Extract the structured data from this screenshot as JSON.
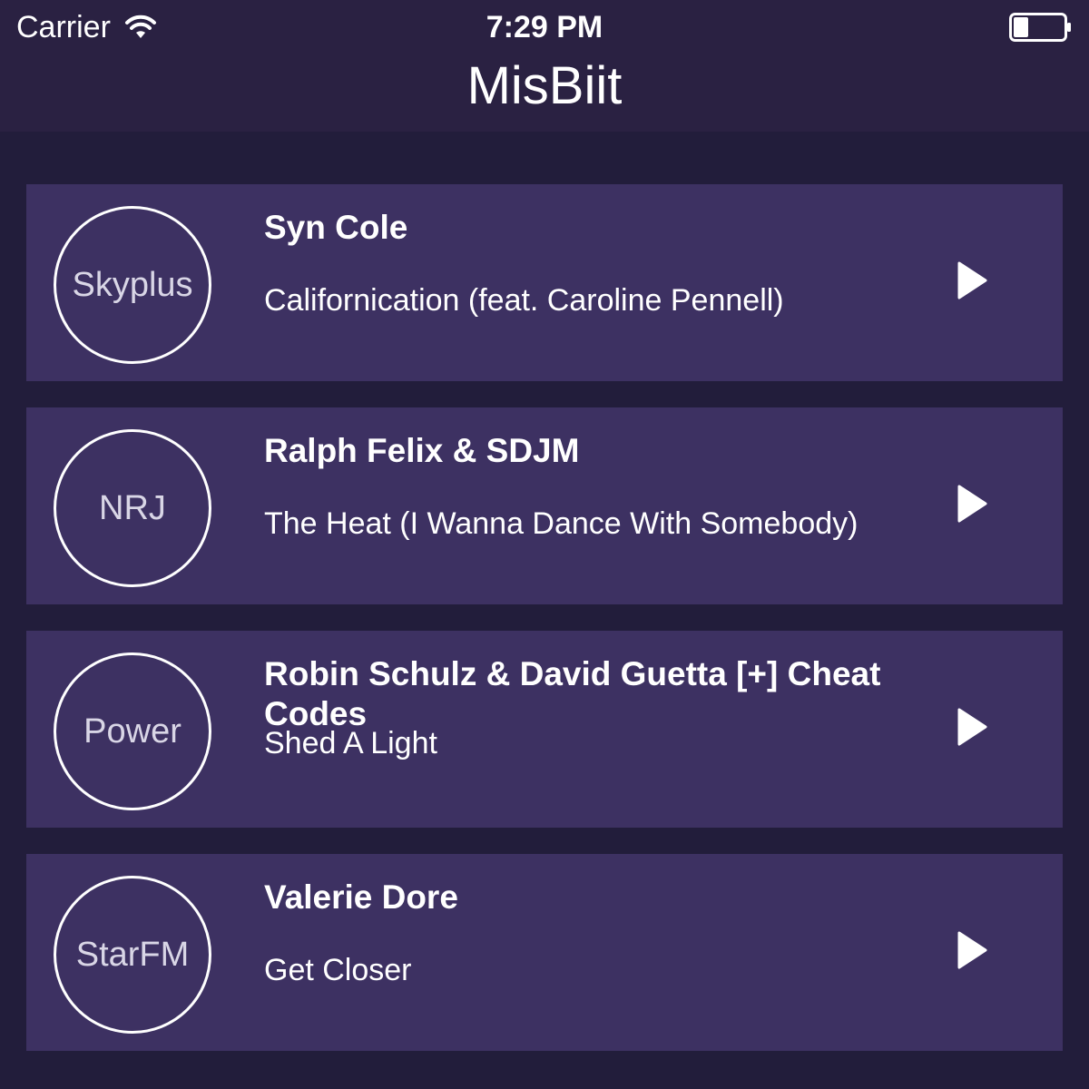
{
  "status_bar": {
    "carrier": "Carrier",
    "time": "7:29 PM"
  },
  "app": {
    "title": "MisBiit"
  },
  "stations": [
    {
      "logo": "Skyplus",
      "artist": "Syn Cole",
      "title": "Californication (feat. Caroline Pennell)"
    },
    {
      "logo": "NRJ",
      "artist": "Ralph Felix & SDJM",
      "title": "The Heat (I Wanna Dance With Somebody)"
    },
    {
      "logo": "Power",
      "artist": "Robin Schulz & David Guetta [+] Cheat Codes",
      "title": "Shed A Light"
    },
    {
      "logo": "StarFM",
      "artist": "Valerie Dore",
      "title": "Get Closer"
    }
  ],
  "icons": {
    "wifi": "wifi-icon",
    "battery": "battery-icon",
    "play": "play-icon"
  },
  "colors": {
    "header_bg": "#2a2142",
    "page_bg": "#221d3b",
    "card_bg": "#3d3162",
    "text": "#ffffff"
  }
}
